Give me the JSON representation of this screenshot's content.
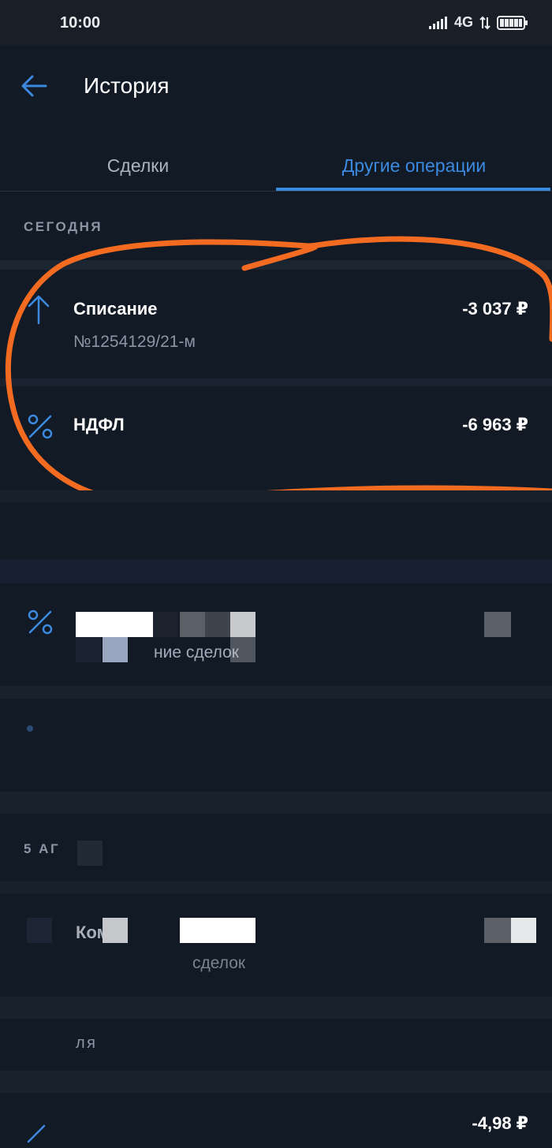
{
  "status_bar": {
    "time": "10:00",
    "network": "4G"
  },
  "header": {
    "title": "История"
  },
  "tabs": [
    {
      "label": "Сделки",
      "active": false
    },
    {
      "label": "Другие операции",
      "active": true
    }
  ],
  "sections": {
    "today": {
      "label": "СЕГОДНЯ"
    },
    "aug5_partial": {
      "label": "5 АГ"
    }
  },
  "operations": [
    {
      "title": "Списание",
      "subtitle": "№1254129/21-м",
      "amount": "-3 037 ₽",
      "icon": "arrow-up-icon"
    },
    {
      "title": "НДФЛ",
      "amount": "-6 963 ₽",
      "icon": "percent-icon"
    }
  ],
  "obscured": {
    "row3_sub": "ние сделок",
    "row5_title": "Коми",
    "row5_sub": "сделок",
    "row6_label": "ля",
    "last_amount": "-4,98 ₽"
  },
  "colors": {
    "background": "#121a26",
    "accent": "#3b8ae0",
    "highlight_stroke": "#f26b21"
  }
}
